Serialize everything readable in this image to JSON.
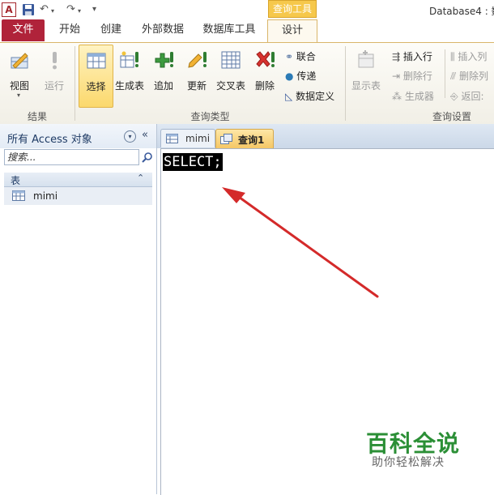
{
  "window": {
    "title": "Database4 : 数",
    "app_icon": "A",
    "context_tab": "查询工具"
  },
  "ribbon_tabs": [
    "文件",
    "开始",
    "创建",
    "外部数据",
    "数据库工具",
    "设计"
  ],
  "ribbon": {
    "results": {
      "label": "结果",
      "view": "视图",
      "run": "运行"
    },
    "query_type": {
      "label": "查询类型",
      "select": "选择",
      "make_table": "生成表",
      "append": "追加",
      "update": "更新",
      "crosstab": "交叉表",
      "delete": "删除",
      "union": "联合",
      "pass_through": "传递",
      "data_definition": "数据定义"
    },
    "query_setup": {
      "label": "查询设置",
      "show_table": "显示表",
      "insert_rows": "插入行",
      "delete_rows": "删除行",
      "builder": "生成器",
      "insert_cols": "插入列",
      "delete_cols": "删除列",
      "return": "返回:"
    }
  },
  "nav_pane": {
    "title": "所有 Access 对象",
    "search_placeholder": "搜索...",
    "group": "表",
    "items": [
      "mimi"
    ]
  },
  "doc_tabs": [
    "mimi",
    "查询1"
  ],
  "editor": {
    "sql": "SELECT;"
  },
  "watermark": {
    "main": "百科全说",
    "sub": "助你轻松解决"
  },
  "colors": {
    "file_tab": "#b0233a",
    "context": "#f6c84b",
    "arrow": "#d42a2a",
    "watermark": "#2b8f36"
  }
}
